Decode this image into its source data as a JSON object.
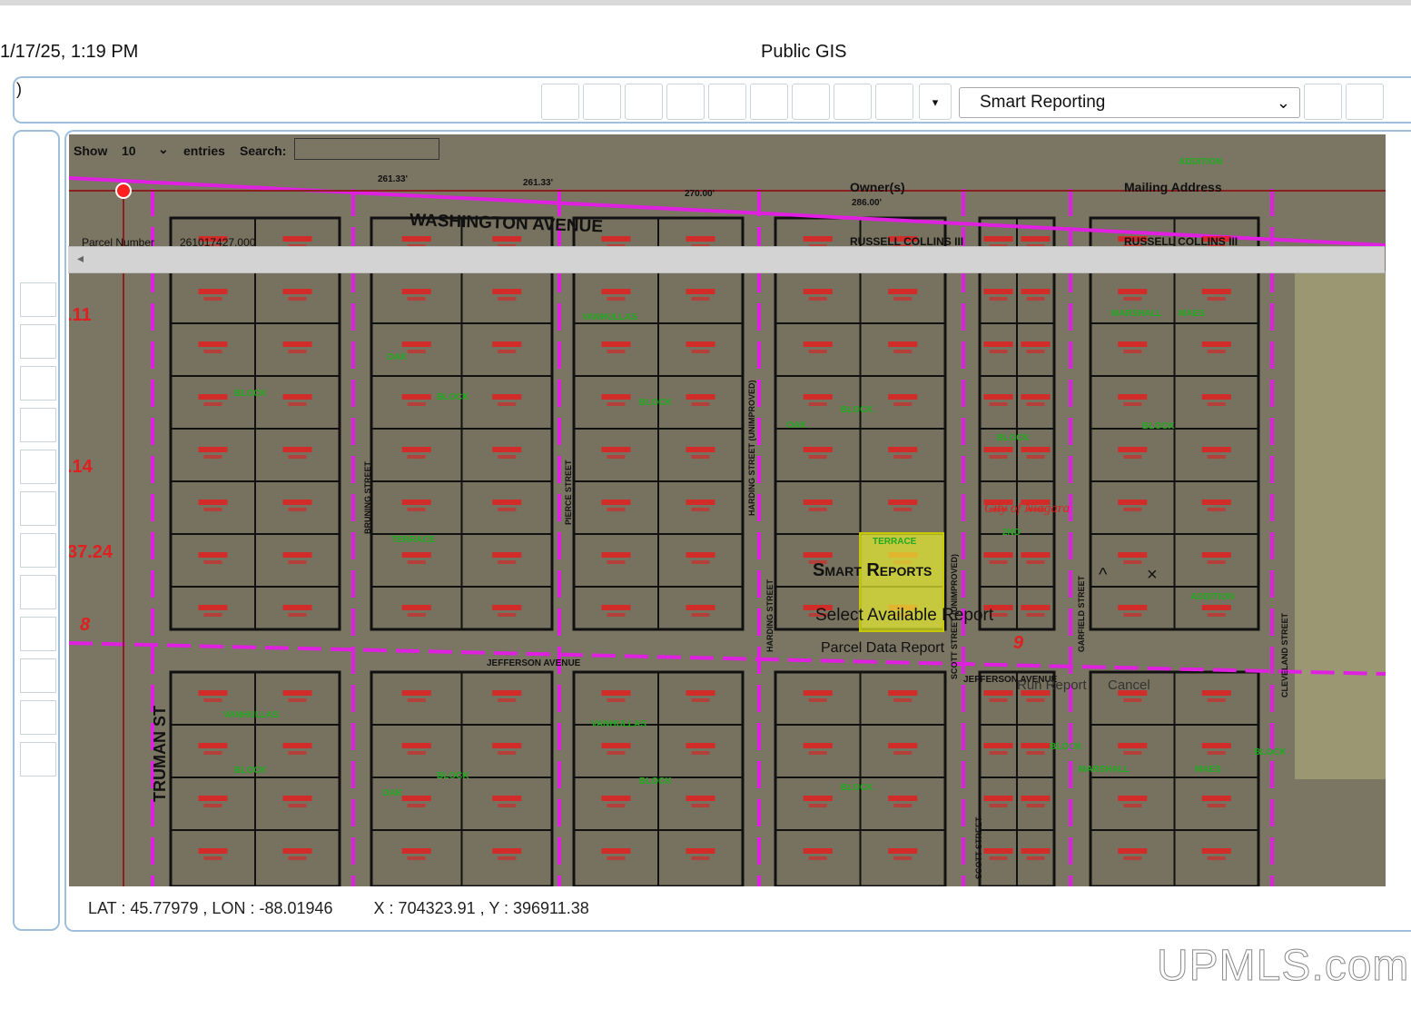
{
  "header": {
    "timestamp": "1/17/25, 1:19 PM",
    "page_title": "Public GIS"
  },
  "toolbar": {
    "paren": ")",
    "dropdown_glyph": "▾",
    "report_select": {
      "value": "Smart Reporting",
      "chevron": "⌄"
    }
  },
  "table_overlay": {
    "show_label": "Show",
    "entries_value": "10",
    "entries_label": "entries",
    "search_label": "Search:",
    "col_owner": "Owner(s)",
    "col_mailing": "Mailing Address",
    "parcel_number_label": "Parcel Number",
    "parcel_number_value": "261017427.000",
    "owner_name_1": "RUSSELL COLLINS III",
    "owner_name_2": "RUSSELL COLLINS III",
    "scroll_left_glyph": "◂"
  },
  "smart_reports": {
    "title": "Smart Reports",
    "minimize_glyph": "^",
    "close_glyph": "×",
    "select_label": "Select Available Report",
    "option": "Parcel Data Report",
    "run_button": "Run Report",
    "cancel_button": "Cancel"
  },
  "map": {
    "streets": {
      "washington": "WASHINGTON AVENUE",
      "jefferson": "JEFFERSON AVENUE",
      "jefferson_east": "JEFFERSON AVENUE",
      "truman": "TRUMAN ST",
      "bruning": "BRUNING STREET",
      "pierce": "PIERCE STREET",
      "harding": "HARDING STREET",
      "harding_unimproved": "HARDING STREET (UNIMPROVED)",
      "scott": "SCOTT STREET",
      "scott_unimproved": "SCOTT STREET (UNIMPROVED)",
      "garfield": "GARFIELD STREET",
      "cleveland": "CLEVELAND STREET"
    },
    "labels": {
      "city": "City of Niagara",
      "vanhullas": "VANHULLAS",
      "oak": "OAK",
      "block": "BLOCK",
      "terrace": "TERRACE",
      "addition": "ADDITION",
      "marshall": "MARSHALL",
      "maes": "MAES",
      "second": "2ND",
      "dim_270": "270.00'",
      "dim_286": "286.00'",
      "dim_261a": "261.33'",
      "dim_261b": "261.33'",
      "margin_11": ".11",
      "margin_14": ".14",
      "margin_3724": "37.24",
      "margin_8": "8",
      "num_9": "9"
    },
    "colors": {
      "boundary": "#e020e0",
      "lot_line": "#111111",
      "parcel_label": "#e02020",
      "subdivision_label": "#1faa1f",
      "marker": "#ff2020",
      "highlight": "#e8f030"
    }
  },
  "status": {
    "lat_lon": "LAT : 45.77979 , LON : -88.01946",
    "xy": "X : 704323.91 , Y : 396911.38"
  },
  "watermark": "UPMLS.com"
}
